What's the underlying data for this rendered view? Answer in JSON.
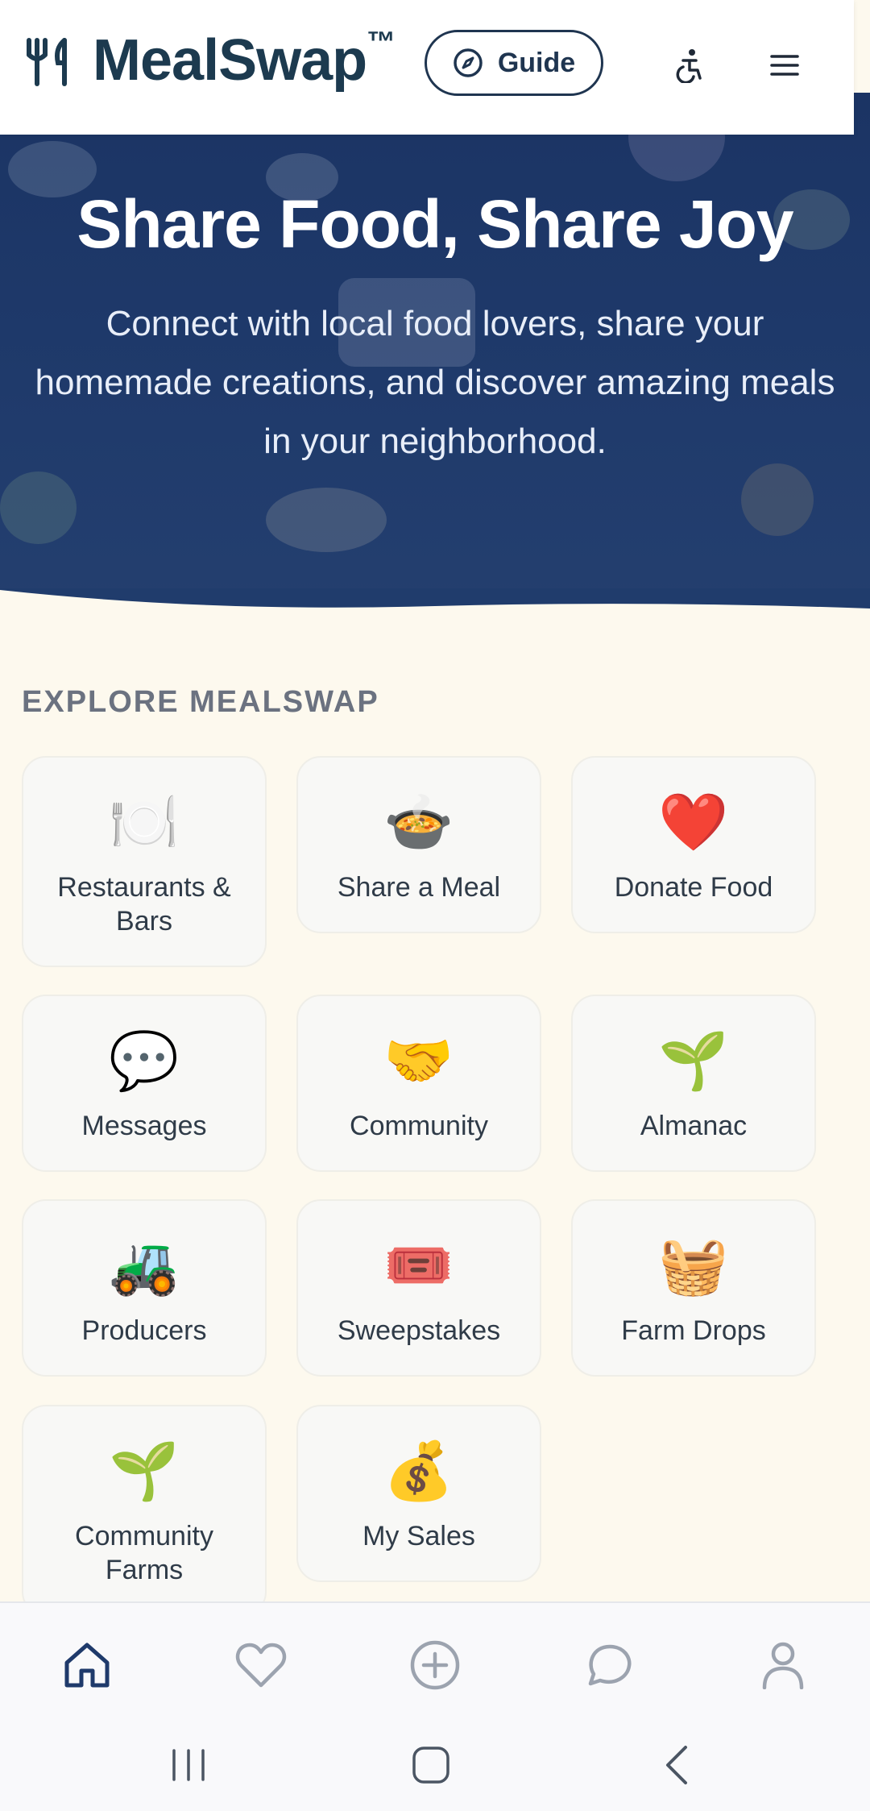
{
  "header": {
    "brand": "MealSwap",
    "trademark": "™",
    "guide_label": "Guide"
  },
  "hero": {
    "title": "Share Food, Share Joy",
    "subtitle": "Connect with local food lovers, share your homemade creations, and discover amazing meals in your neighborhood."
  },
  "explore": {
    "title": "EXPLORE MEALSWAP",
    "cards": [
      {
        "emoji": "🍽️",
        "label": "Restaurants & Bars"
      },
      {
        "emoji": "🍲",
        "label": "Share a Meal"
      },
      {
        "emoji": "❤️",
        "label": "Donate Food"
      },
      {
        "emoji": "💬",
        "label": "Messages"
      },
      {
        "emoji": "🤝",
        "label": "Community"
      },
      {
        "emoji": "🌱",
        "label": "Almanac"
      },
      {
        "emoji": "🚜",
        "label": "Producers"
      },
      {
        "emoji": "🎟️",
        "label": "Sweepstakes"
      },
      {
        "emoji": "🧺",
        "label": "Farm Drops"
      },
      {
        "emoji": "🌱",
        "label": "Community Farms"
      },
      {
        "emoji": "💰",
        "label": "My Sales"
      }
    ]
  },
  "bottom_nav": {
    "items": [
      "home-icon",
      "heart-icon",
      "plus-circle-icon",
      "chat-icon",
      "user-icon"
    ],
    "active": "home-icon"
  },
  "colors": {
    "brand_navy": "#1c3a4f",
    "hero_bg": "#1f3a6b",
    "page_bg": "#fdf9ee",
    "card_bg": "#f8f8f6"
  }
}
